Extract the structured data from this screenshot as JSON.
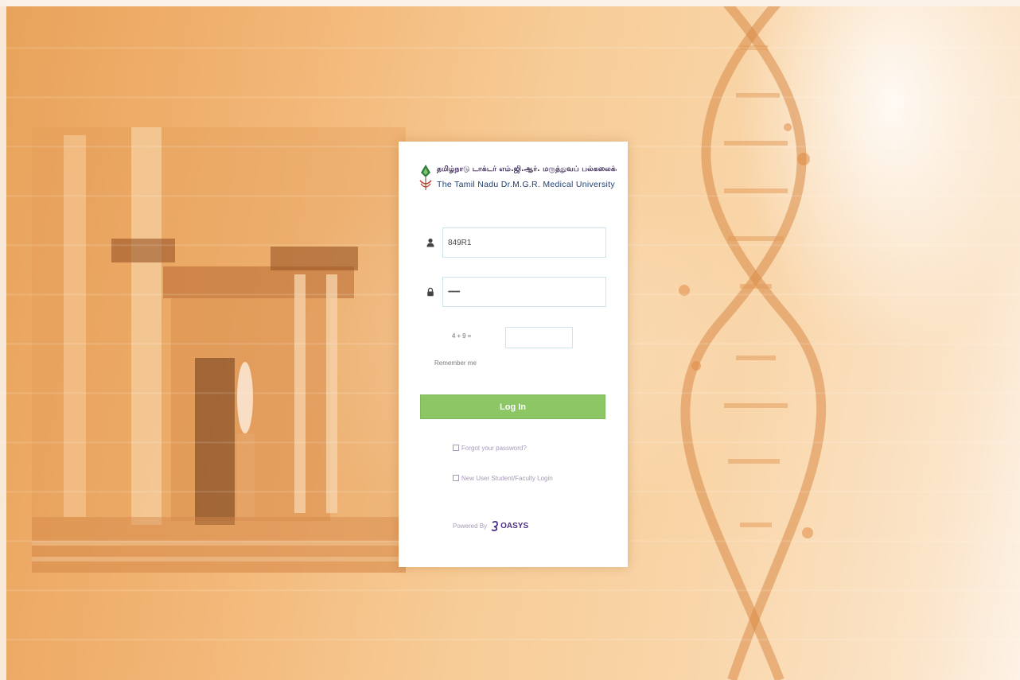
{
  "university": {
    "name_tamil": "தமிழ்நாடு டாக்டர் எம்.ஜி.ஆர். மருத்துவப் பல்கலைக்கழகம்",
    "name_english": "The Tamil Nadu Dr.M.G.R. Medical University"
  },
  "form": {
    "username_value": "849R1",
    "password_value": "••••••••••",
    "captcha_question": "4+9=",
    "captcha_value": "",
    "remember_label": "Remember me",
    "login_label": "Log In"
  },
  "links": {
    "forgot_password": "Forgot your password?",
    "new_user": "New User Student/Faculty Login"
  },
  "footer": {
    "powered_by": "Powered By",
    "vendor": "OASYS"
  },
  "colors": {
    "login_button": "#8cc665",
    "field_border": "#cfe3ea",
    "background_accent": "#f2b574"
  },
  "icons": {
    "username": "user-icon",
    "password": "lock-icon",
    "logo": "university-logo-icon",
    "vendor": "oasys-logo-icon"
  }
}
